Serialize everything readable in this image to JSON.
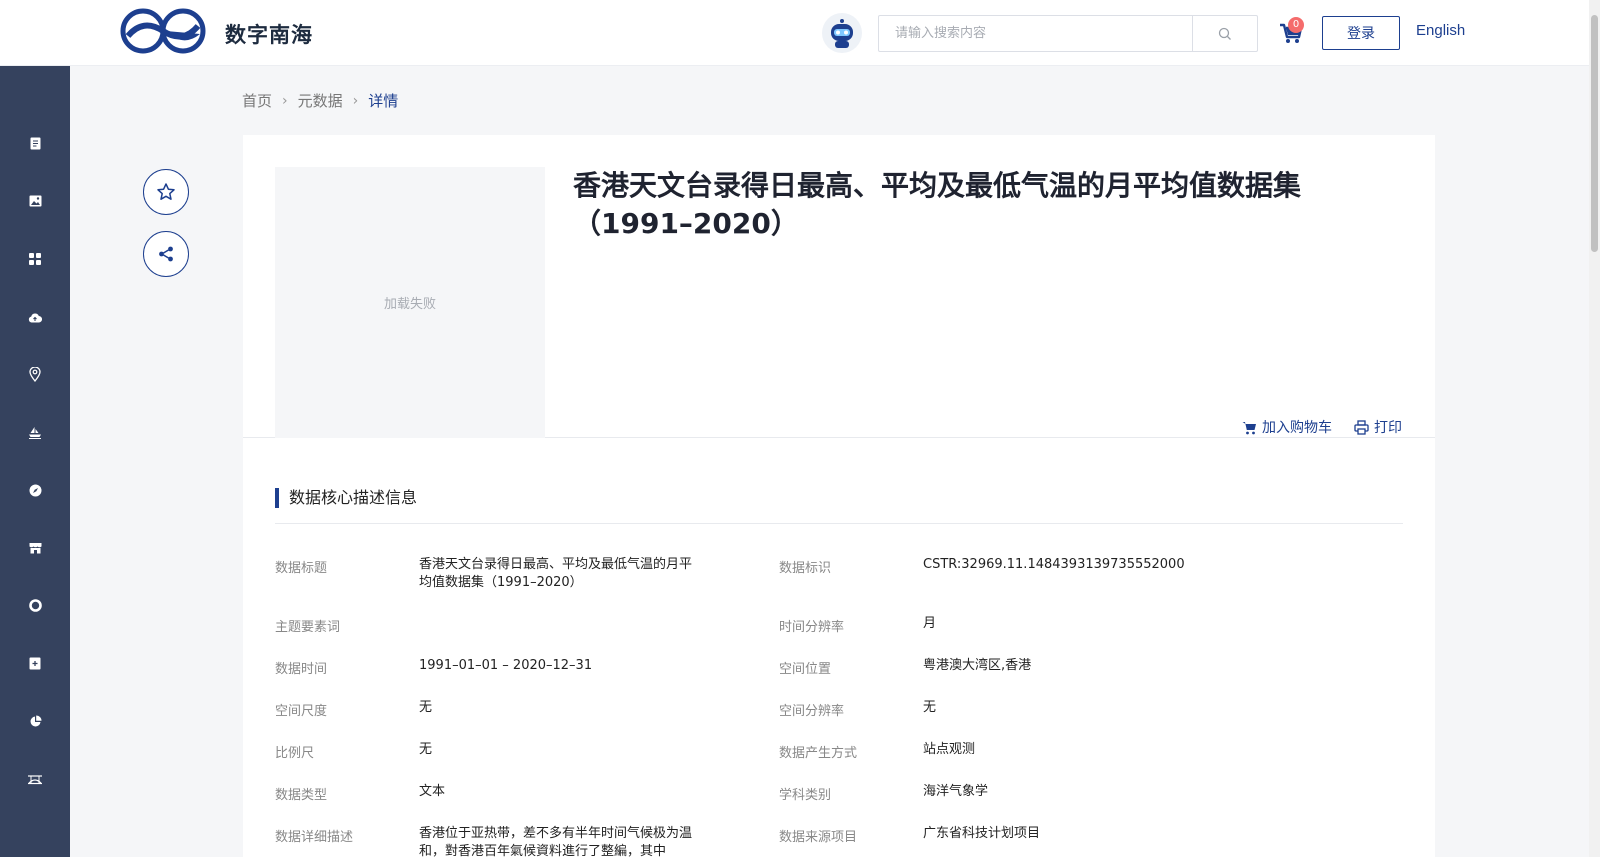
{
  "header": {
    "site_name": "数字南海",
    "search_placeholder": "请输入搜索内容",
    "cart_count": "0",
    "login_label": "登录",
    "language_label": "English",
    "brand_color": "#1d3f8f"
  },
  "sidebar": {
    "background": "#35425e",
    "items": [
      {
        "icon": "document-icon"
      },
      {
        "icon": "image-icon"
      },
      {
        "icon": "grid-icon"
      },
      {
        "icon": "cloud-upload-icon"
      },
      {
        "icon": "location-pin-icon"
      },
      {
        "icon": "ship-icon"
      },
      {
        "icon": "compass-icon"
      },
      {
        "icon": "store-icon"
      },
      {
        "icon": "lifebuoy-icon"
      },
      {
        "icon": "add-document-icon"
      },
      {
        "icon": "pie-chart-icon"
      },
      {
        "icon": "bridge-icon"
      }
    ]
  },
  "breadcrumb": {
    "home": "首页",
    "metadata": "元数据",
    "current": "详情"
  },
  "detail": {
    "thumbnail_text": "加载失败",
    "title": "香港天文台录得日最高、平均及最低气温的月平均值数据集（1991–2020）",
    "add_to_cart": "加入购物车",
    "print": "打印"
  },
  "core_info": {
    "section_title": "数据核心描述信息",
    "left_fields": [
      {
        "label": "数据标题",
        "value": "香港天文台录得日最高、平均及最低气温的月平均值数据集（1991–2020）"
      },
      {
        "label": "主题要素词",
        "value": ""
      },
      {
        "label": "数据时间",
        "value": "1991–01–01 – 2020–12–31"
      },
      {
        "label": "空间尺度",
        "value": "无"
      },
      {
        "label": "比例尺",
        "value": "无"
      },
      {
        "label": "数据类型",
        "value": "文本"
      },
      {
        "label": "数据详细描述",
        "value": "香港位于亚热带，差不多有半年时间气候极为温和，對香港百年氣候資料進行了整編，其中"
      }
    ],
    "right_fields": [
      {
        "label": "数据标识",
        "value": "CSTR:32969.11.1484393139735552000"
      },
      {
        "label": "时间分辨率",
        "value": "月"
      },
      {
        "label": "空间位置",
        "value": "粤港澳大湾区,香港"
      },
      {
        "label": "空间分辨率",
        "value": "无"
      },
      {
        "label": "数据产生方式",
        "value": "站点观测"
      },
      {
        "label": "学科类别",
        "value": "海洋气象学"
      },
      {
        "label": "数据来源项目",
        "value": "广东省科技计划项目"
      }
    ]
  }
}
